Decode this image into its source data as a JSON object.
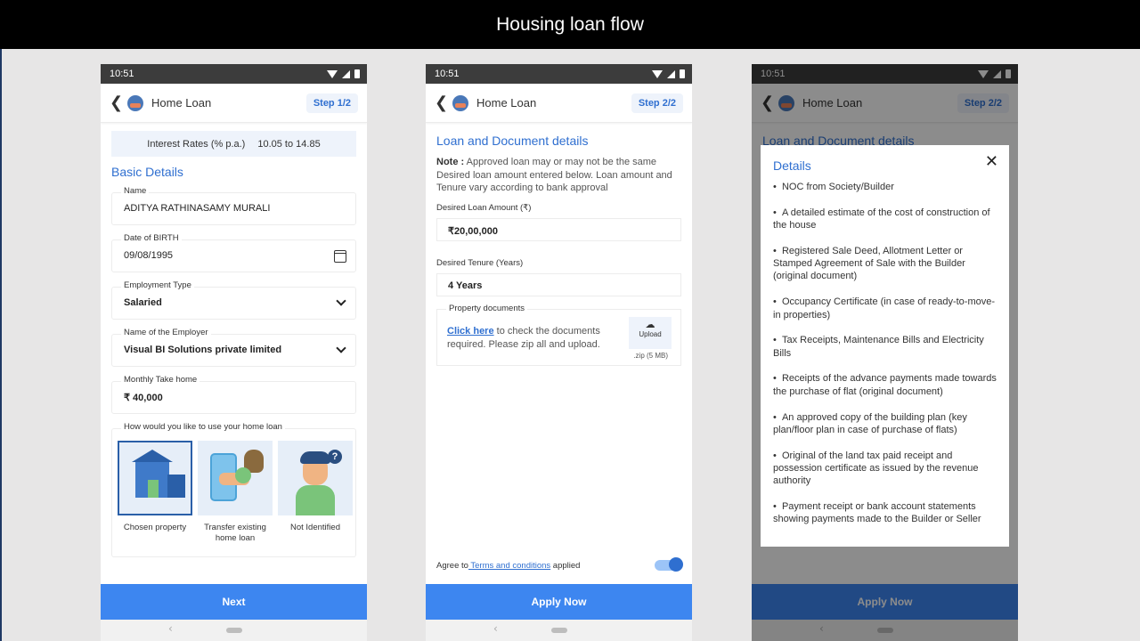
{
  "banner": {
    "title": "Housing loan flow"
  },
  "status": {
    "time": "10:51"
  },
  "app": {
    "title": "Home Loan"
  },
  "screen1": {
    "step": "Step 1/2",
    "rate_label": "Interest Rates (% p.a.)",
    "rate_value": "10.05 to 14.85",
    "section_title": "Basic Details",
    "fields": [
      {
        "label": "Name",
        "value": "ADITYA RATHINASAMY MURALI"
      },
      {
        "label": "Date of BIRTH",
        "value": "09/08/1995"
      },
      {
        "label": "Employment Type",
        "value": "Salaried"
      },
      {
        "label": "Name of the Employer",
        "value": "Visual BI Solutions private limited"
      },
      {
        "label": "Monthly Take home",
        "value": "₹ 40,000"
      }
    ],
    "usage_label": "How would you like to use your home loan",
    "options": [
      {
        "label": "Chosen property",
        "selected": true
      },
      {
        "label": "Transfer existing home loan",
        "selected": false
      },
      {
        "label": "Not Identified",
        "selected": false
      }
    ],
    "cta": "Next"
  },
  "screen2": {
    "step": "Step 2/2",
    "title": "Loan and Document details",
    "note_prefix": "Note :",
    "note_text": " Approved loan may or may not be the same Desired loan amount entered below. Loan amount and Tenure vary according to bank approval",
    "amount_label": "Desired Loan Amount (₹)",
    "amount_value": "₹20,00,000",
    "tenure_label": "Desired Tenure (Years)",
    "tenure_value": "4 Years",
    "docs_label": "Property documents",
    "docs_link": "Click here",
    "docs_text": " to check the documents required. Please zip all and upload.",
    "upload_label": "Upload",
    "upload_note": ".zip (5 MB)",
    "agree_prefix": "Agree to",
    "agree_link": " Terms and conditions",
    "agree_suffix": " applied",
    "toggle_on": true,
    "cta": "Apply Now"
  },
  "screen3": {
    "step": "Step 2/2",
    "bg_title": "Loan and Document details",
    "modal_title": "Details",
    "items": [
      "NOC from Society/Builder",
      "A detailed estimate of the cost of construction of the house",
      "Registered Sale Deed, Allotment Letter or Stamped Agreement of Sale with the Builder (original document)",
      "Occupancy Certificate (in case of ready-to-move-in properties)",
      "Tax Receipts, Maintenance Bills and Electricity Bills",
      "Receipts of the advance payments made towards the purchase of flat (original document)",
      "An approved copy of the building plan (key plan/floor plan in case of purchase of flats)",
      "Original of the land tax paid receipt and possession certificate as issued by the revenue authority",
      "Payment receipt or bank account statements showing payments made to the Builder or Seller"
    ],
    "cta": "Apply Now"
  },
  "colors": {
    "accent": "#2f6fd0",
    "cta": "#3d86f0",
    "banner": "#000000"
  }
}
